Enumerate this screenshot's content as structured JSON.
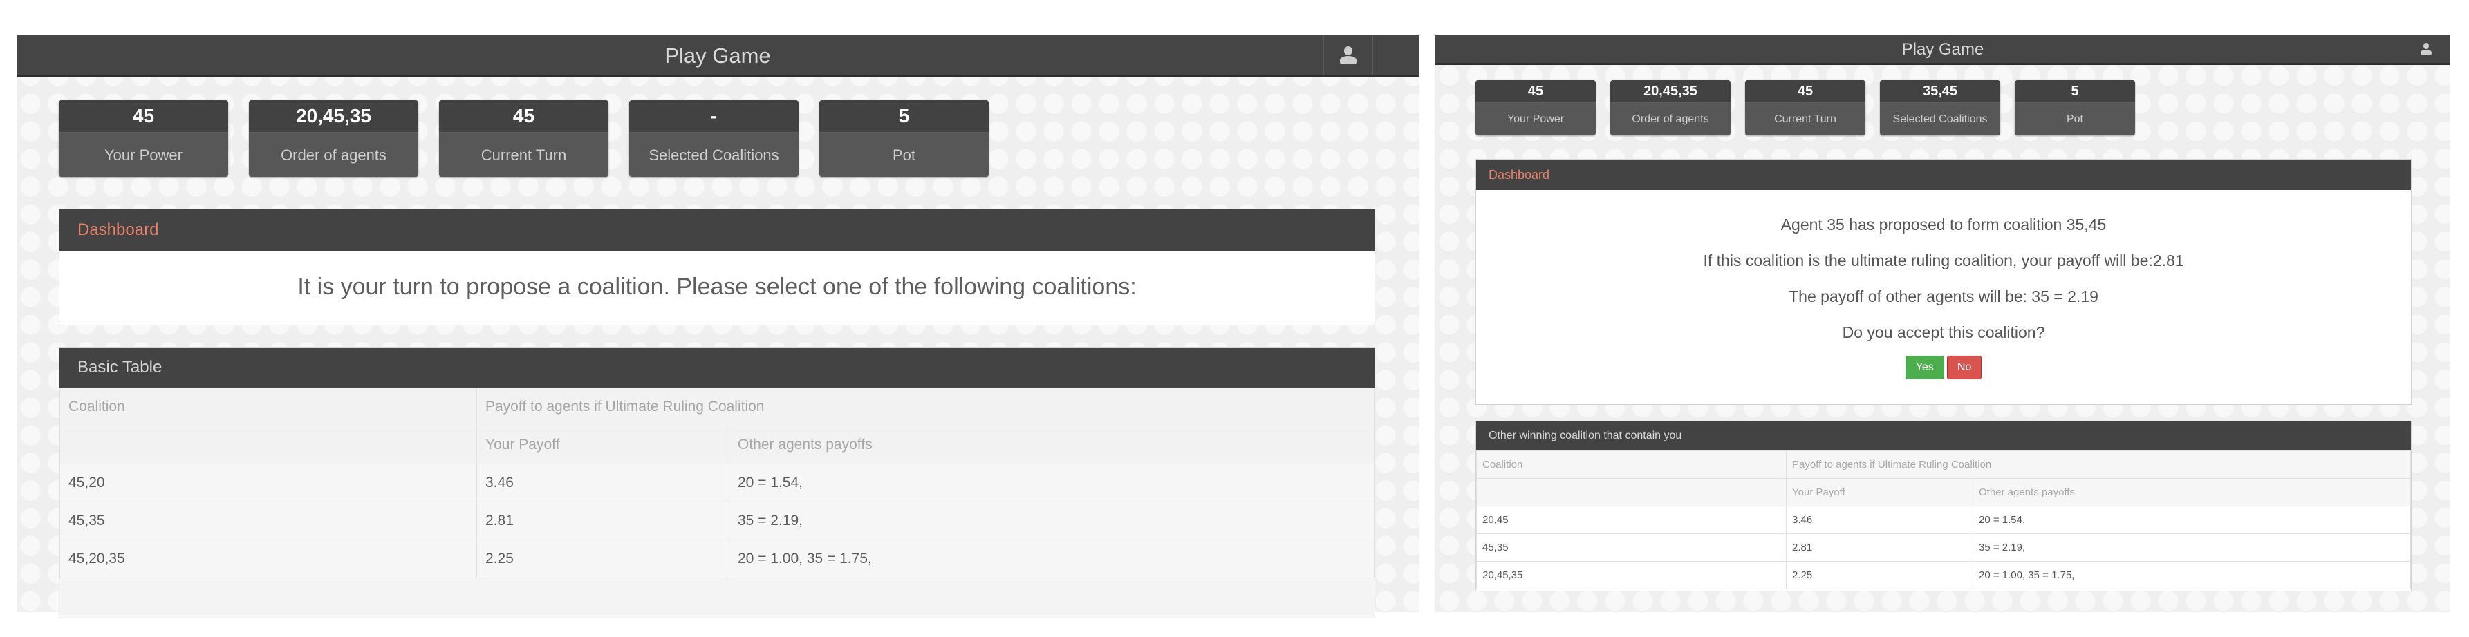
{
  "left": {
    "title": "Play Game",
    "stats": [
      {
        "value": "45",
        "label": "Your Power"
      },
      {
        "value": "20,45,35",
        "label": "Order of agents"
      },
      {
        "value": "45",
        "label": "Current Turn"
      },
      {
        "value": "-",
        "label": "Selected Coalitions"
      },
      {
        "value": "5",
        "label": "Pot"
      }
    ],
    "dashboard": {
      "title": "Dashboard",
      "prompt": "It is your turn to propose a coalition. Please select one of the following coalitions:"
    },
    "table": {
      "title": "Basic Table",
      "col_coalition": "Coalition",
      "col_payoff_group": "Payoff to agents if Ultimate Ruling Coalition",
      "col_your_payoff": "Your Payoff",
      "col_other_payoffs": "Other agents payoffs",
      "rows": [
        {
          "coalition": "45,20",
          "your": "3.46",
          "others": "20 = 1.54,"
        },
        {
          "coalition": "45,35",
          "your": "2.81",
          "others": "35 = 2.19,"
        },
        {
          "coalition": "45,20,35",
          "your": "2.25",
          "others": "20 = 1.00, 35 = 1.75,"
        }
      ]
    }
  },
  "right": {
    "title": "Play Game",
    "stats": [
      {
        "value": "45",
        "label": "Your Power"
      },
      {
        "value": "20,45,35",
        "label": "Order of agents"
      },
      {
        "value": "45",
        "label": "Current Turn"
      },
      {
        "value": "35,45",
        "label": "Selected Coalitions"
      },
      {
        "value": "5",
        "label": "Pot"
      }
    ],
    "dashboard": {
      "title": "Dashboard",
      "proposal": "Agent 35 has proposed to form coalition 35,45",
      "your_payoff": "If this coalition is the ultimate ruling coalition, your payoff will be:2.81",
      "other_payoff": "The payoff of other agents will be: 35 = 2.19",
      "question": "Do you accept this coalition?",
      "yes_label": "Yes",
      "no_label": "No"
    },
    "table": {
      "title": "Other winning coalition that contain you",
      "col_coalition": "Coalition",
      "col_payoff_group": "Payoff to agents if Ultimate Ruling Coalition",
      "col_your_payoff": "Your Payoff",
      "col_other_payoffs": "Other agents payoffs",
      "rows": [
        {
          "coalition": "20,45",
          "your": "3.46",
          "others": "20 = 1.54,"
        },
        {
          "coalition": "45,35",
          "your": "2.81",
          "others": "35 = 2.19,"
        },
        {
          "coalition": "20,45,35",
          "your": "2.25",
          "others": "20 = 1.00, 35 = 1.75,"
        }
      ]
    }
  },
  "colors": {
    "header_bg": "#454545",
    "accent": "#e8826c",
    "yes": "#4cae4c",
    "no": "#d9534f"
  }
}
